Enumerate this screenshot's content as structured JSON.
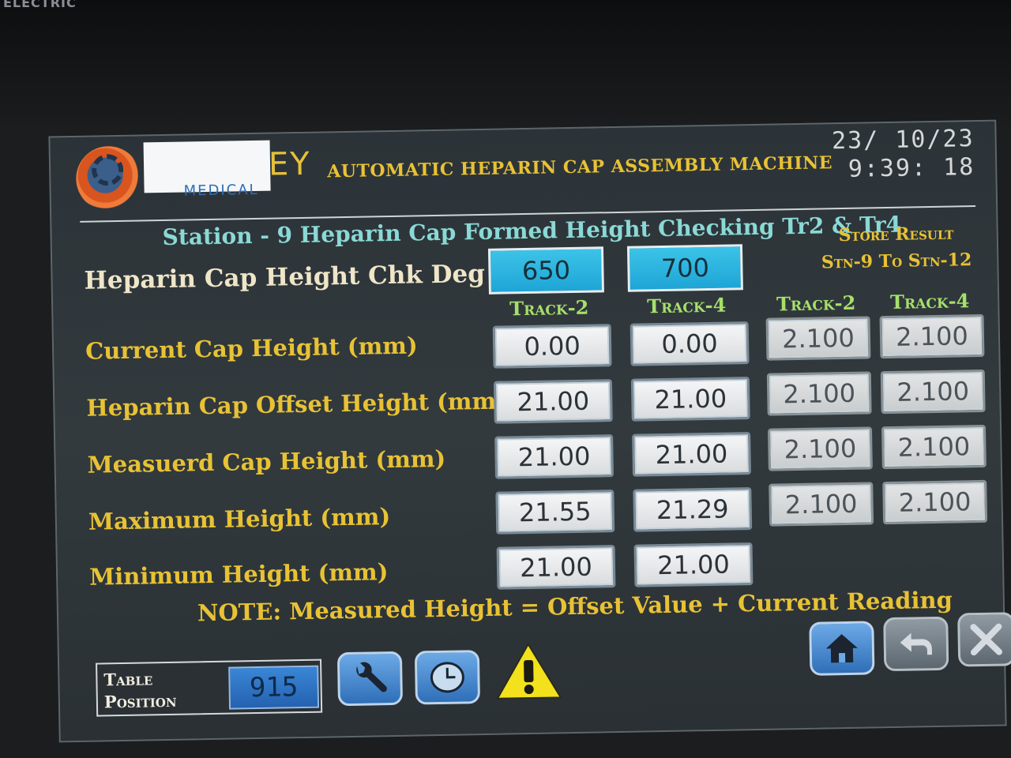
{
  "header": {
    "brand_corner": "ELECTRIC",
    "logo_tail": "EY",
    "logo_sub": "MEDICAL",
    "title": "AUTOMATIC HEPARIN CAP ASSEMBLY MACHINE",
    "date": "23/ 10/23",
    "time": "9:39: 18"
  },
  "station": {
    "title": "Station - 9 Heparin Cap Formed Height Checking Tr2 & Tr4",
    "store_result_line1": "Store Result",
    "store_result_line2": "Stn-9 To Stn-12"
  },
  "check_degree": {
    "label": "Heparin Cap Height Chk Deg",
    "track2": "650",
    "track4": "700"
  },
  "columns": {
    "track2": "Track-2",
    "track4": "Track-4",
    "store_track2": "Track-2",
    "store_track4": "Track-4"
  },
  "rows": [
    {
      "label": "Current Cap Height (mm)",
      "track2": "0.00",
      "track4": "0.00",
      "store_track2": "2.100",
      "store_track4": "2.100"
    },
    {
      "label": "Heparin Cap Offset Height (mm)",
      "track2": "21.00",
      "track4": "21.00",
      "store_track2": "2.100",
      "store_track4": "2.100"
    },
    {
      "label": "Measuerd Cap Height (mm)",
      "track2": "21.00",
      "track4": "21.00",
      "store_track2": "2.100",
      "store_track4": "2.100"
    },
    {
      "label": "Maximum Height (mm)",
      "track2": "21.55",
      "track4": "21.29",
      "store_track2": "2.100",
      "store_track4": "2.100"
    },
    {
      "label": "Minimum Height (mm)",
      "track2": "21.00",
      "track4": "21.00"
    }
  ],
  "note": "NOTE: Measured Height = Offset Value + Current Reading",
  "footer": {
    "table_position_line1": "Table",
    "table_position_line2": "Position",
    "table_position_value": "915",
    "icons": [
      "wrench-icon",
      "clock-icon",
      "warning-icon",
      "home-icon",
      "back-icon",
      "close-icon"
    ]
  },
  "colors": {
    "accent_yellow": "#e8c234",
    "heading_cyan": "#8ad9d6",
    "track_green": "#a6e06a",
    "input_blue": "#1ea5d6",
    "screen_bg": "#2c3338"
  }
}
